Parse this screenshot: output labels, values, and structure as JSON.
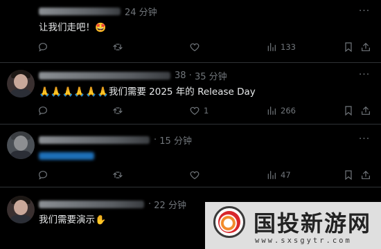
{
  "colors": {
    "background": "#000000",
    "text": "#e7e9ea",
    "muted": "#71767b",
    "divider": "#2f3336"
  },
  "tweets": [
    {
      "time": "24 分钟",
      "time_prefix": "",
      "text": "让我们走吧！",
      "emoji": "🤩",
      "stats": {
        "replies": "",
        "retweets": "",
        "likes": "",
        "views": "133"
      }
    },
    {
      "time": "35 分钟",
      "time_prefix": "38 ·",
      "text": "🙏🙏🙏🙏🙏🙏我们需要 2025 年的 Release Day",
      "emoji": "",
      "stats": {
        "replies": "",
        "retweets": "",
        "likes": "1",
        "views": "266"
      }
    },
    {
      "time": "15 分钟",
      "time_prefix": "·",
      "text": "",
      "emoji": "",
      "stats": {
        "replies": "",
        "retweets": "",
        "likes": "",
        "views": "47"
      }
    },
    {
      "time": "22 分钟",
      "time_prefix": "·",
      "text": "我们需要演示",
      "emoji": "✋",
      "stats": {}
    }
  ],
  "icons": {
    "reply": "reply-icon",
    "retweet": "retweet-icon",
    "like": "heart-icon",
    "views": "views-icon",
    "bookmark": "bookmark-icon",
    "share": "share-icon",
    "more": "more-icon"
  },
  "more_label": "···",
  "watermark": {
    "title": "国投新游网",
    "url": "www.sxsgytr.com"
  }
}
